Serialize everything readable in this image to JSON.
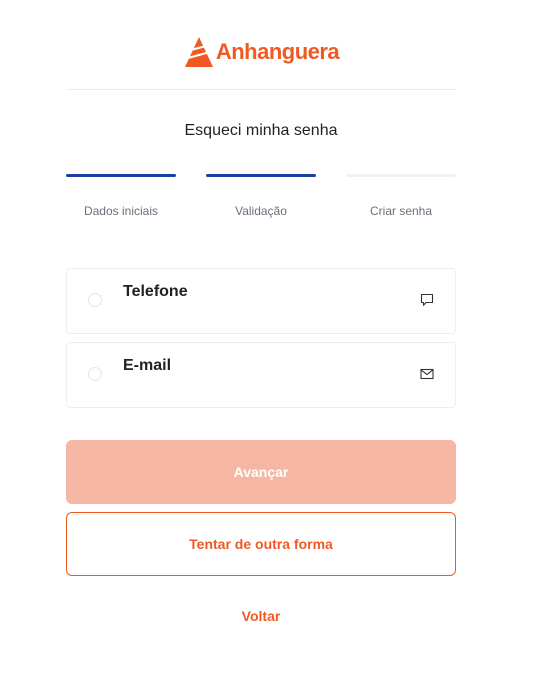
{
  "brand": {
    "name": "Anhanguera",
    "color": "#f05a22",
    "logo_icon": "anhanguera-triangle-logo"
  },
  "page": {
    "title": "Esqueci minha senha"
  },
  "steps": [
    {
      "label": "Dados iniciais",
      "active": true
    },
    {
      "label": "Validação",
      "active": true
    },
    {
      "label": "Criar senha",
      "active": false
    }
  ],
  "options": [
    {
      "title": "Telefone",
      "icon": "message-icon",
      "selected": false
    },
    {
      "title": "E-mail",
      "icon": "mail-icon",
      "selected": false
    }
  ],
  "actions": {
    "primary_label": "Avançar",
    "secondary_label": "Tentar de outra forma",
    "back_label": "Voltar"
  },
  "colors": {
    "accent": "#f05a22",
    "step_active": "#1a3fa0",
    "primary_disabled": "#f5b7a4"
  }
}
